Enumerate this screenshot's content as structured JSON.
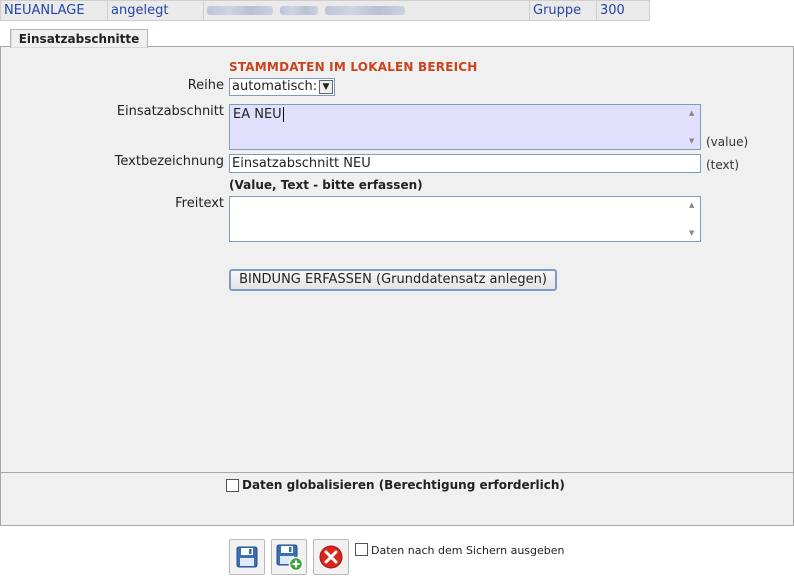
{
  "header": {
    "mode": "NEUANLAGE",
    "status": "angelegt",
    "group_label": "Gruppe",
    "group_value": "300"
  },
  "tab": {
    "label": "Einsatzabschnitte"
  },
  "form": {
    "section_title": "STAMMDATEN IM LOKALEN BEREICH",
    "reihe_label": "Reihe",
    "reihe_value": "automatisch:",
    "einsatzabschnitt_label": "Einsatzabschnitt",
    "einsatzabschnitt_value": "EA NEU",
    "einsatzabschnitt_hint": "(value)",
    "textbezeichnung_label": "Textbezeichnung",
    "textbezeichnung_value": "Einsatzabschnitt NEU",
    "textbezeichnung_hint": "(text)",
    "required_note": "(Value, Text - bitte erfassen)",
    "freitext_label": "Freitext",
    "freitext_value": "",
    "bind_button_label": "BINDUNG ERFASSEN (Grunddatensatz anlegen)"
  },
  "footer": {
    "globalize_label": "Daten globalisieren (Berechtigung erforderlich)",
    "output_after_save_label": "Daten nach dem Sichern ausgeben",
    "icons": [
      "save-icon",
      "save-new-icon",
      "cancel-icon"
    ],
    "colors": {
      "save_blue": "#3a6fb5",
      "add_green": "#3aa53a",
      "cancel_red": "#d9261c"
    }
  }
}
